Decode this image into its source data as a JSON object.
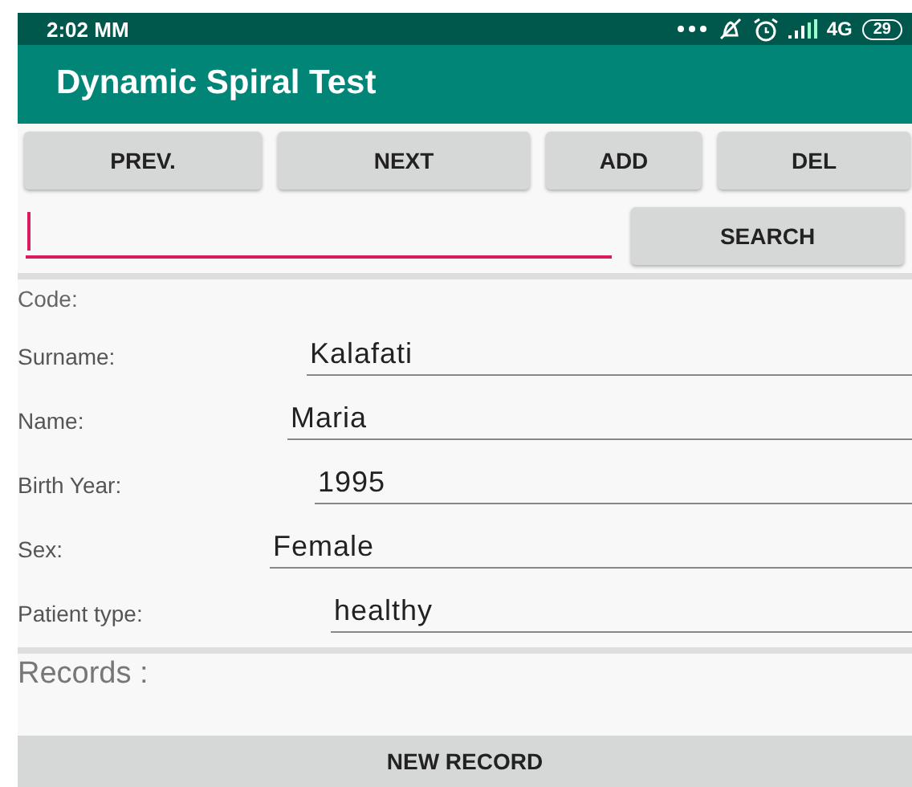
{
  "status_bar": {
    "time": "2:02 MM",
    "network": "4G",
    "battery": "29"
  },
  "app_bar": {
    "title": "Dynamic Spiral Test"
  },
  "nav_buttons": [
    "PREV.",
    "NEXT",
    "ADD",
    "DEL"
  ],
  "search": {
    "focused": true,
    "button": "SEARCH"
  },
  "code_label": "Code:",
  "fields": [
    {
      "label": "Surname:",
      "value": "Kalafati"
    },
    {
      "label": "Name:",
      "value": "Maria"
    },
    {
      "label": "Birth Year:",
      "value": "1995"
    },
    {
      "label": "Sex:",
      "value": "Female"
    },
    {
      "label": "Patient type:",
      "value": "healthy"
    }
  ],
  "records_label": "Records :",
  "new_record_button": "NEW RECORD"
}
